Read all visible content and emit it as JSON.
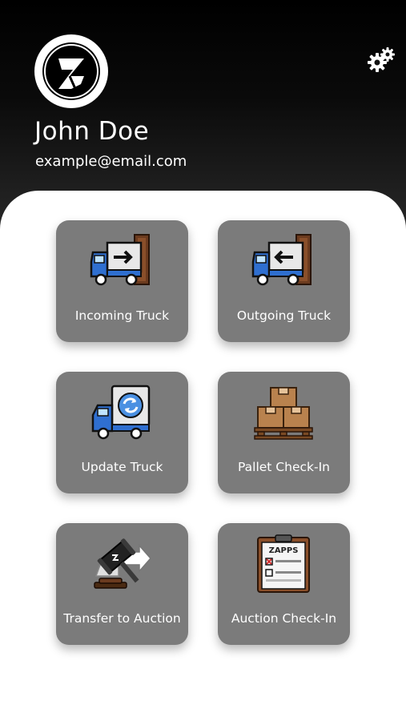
{
  "user": {
    "name": "John Doe",
    "email": "example@email.com"
  },
  "header": {
    "logo_icon": "zapps-logo",
    "settings_icon": "gear-icon"
  },
  "colors": {
    "header_background": "#000000",
    "tile_background": "#7b7b7b",
    "truck_blue": "#2f6fd0",
    "box_brown": "#b9824e"
  },
  "menu": {
    "items": [
      {
        "label": "Incoming Truck",
        "icon": "incoming-truck-icon"
      },
      {
        "label": "Outgoing Truck",
        "icon": "outgoing-truck-icon"
      },
      {
        "label": "Update Truck",
        "icon": "update-truck-icon"
      },
      {
        "label": "Pallet Check-In",
        "icon": "pallet-boxes-icon"
      },
      {
        "label": "Transfer to Auction",
        "icon": "auction-gavel-icon"
      },
      {
        "label": "Auction Check-In",
        "icon": "clipboard-checklist-icon"
      }
    ],
    "clipboard_text": "ZAPPS"
  }
}
